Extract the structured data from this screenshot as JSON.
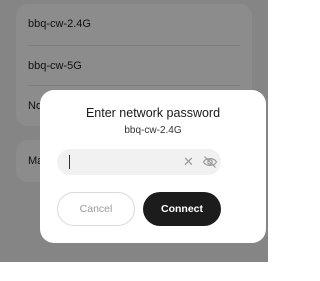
{
  "networks": [
    {
      "ssid": "bbq-cw-2.4G"
    },
    {
      "ssid": "bbq-cw-5G"
    },
    {
      "ssid": "No"
    }
  ],
  "manage": {
    "label": "Ma"
  },
  "dialog": {
    "title": "Enter network password",
    "ssid": "bbq-cw-2.4G",
    "password_value": "",
    "cancel_label": "Cancel",
    "connect_label": "Connect"
  },
  "colors": {
    "connect_button": "#1c1c1c",
    "overlay": "rgba(0,0,0,0.45)"
  },
  "icons": [
    "clear-icon",
    "eye-off-icon",
    "chevron-right-icon"
  ]
}
